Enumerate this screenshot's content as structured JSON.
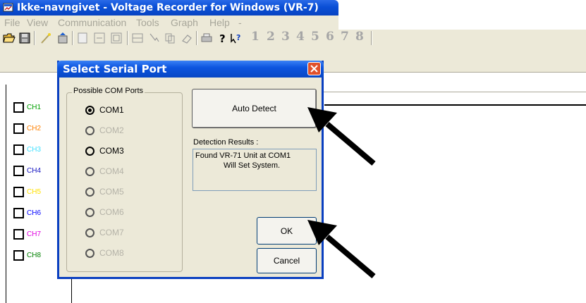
{
  "window": {
    "title": "Ikke-navngivet - Voltage Recorder for Windows (VR-7)"
  },
  "menu": [
    "File",
    "View",
    "Communication",
    "Tools",
    "Graph",
    "Help"
  ],
  "menu_trailing": "-",
  "toolbar": {
    "channel_numbers": [
      "1",
      "2",
      "3",
      "4",
      "5",
      "6",
      "7",
      "8"
    ]
  },
  "channels": [
    {
      "label": "CH1",
      "color": "#00a000"
    },
    {
      "label": "CH2",
      "color": "#ff8000"
    },
    {
      "label": "CH3",
      "color": "#40e0ff"
    },
    {
      "label": "CH4",
      "color": "#1010c0"
    },
    {
      "label": "CH5",
      "color": "#ffe000"
    },
    {
      "label": "CH6",
      "color": "#0000ff"
    },
    {
      "label": "CH7",
      "color": "#e000e0"
    },
    {
      "label": "CH8",
      "color": "#008000"
    }
  ],
  "dialog": {
    "title": "Select Serial Port",
    "group_caption": "Possible COM Ports",
    "ports": [
      {
        "label": "COM1",
        "selected": true,
        "enabled": true
      },
      {
        "label": "COM2",
        "selected": false,
        "enabled": false
      },
      {
        "label": "COM3",
        "selected": false,
        "enabled": true
      },
      {
        "label": "COM4",
        "selected": false,
        "enabled": false
      },
      {
        "label": "COM5",
        "selected": false,
        "enabled": false
      },
      {
        "label": "COM6",
        "selected": false,
        "enabled": false
      },
      {
        "label": "COM7",
        "selected": false,
        "enabled": false
      },
      {
        "label": "COM8",
        "selected": false,
        "enabled": false
      }
    ],
    "auto_detect_label": "Auto Detect",
    "detection_label": "Detection Results :",
    "detection_line1": "Found VR-71 Unit at COM1",
    "detection_line2": "Will Set System.",
    "ok_label": "OK",
    "cancel_label": "Cancel"
  },
  "colors": {
    "titlebar": "#0a4fd6",
    "dialog_border": "#0a3fc0",
    "face": "#ece9d8"
  }
}
